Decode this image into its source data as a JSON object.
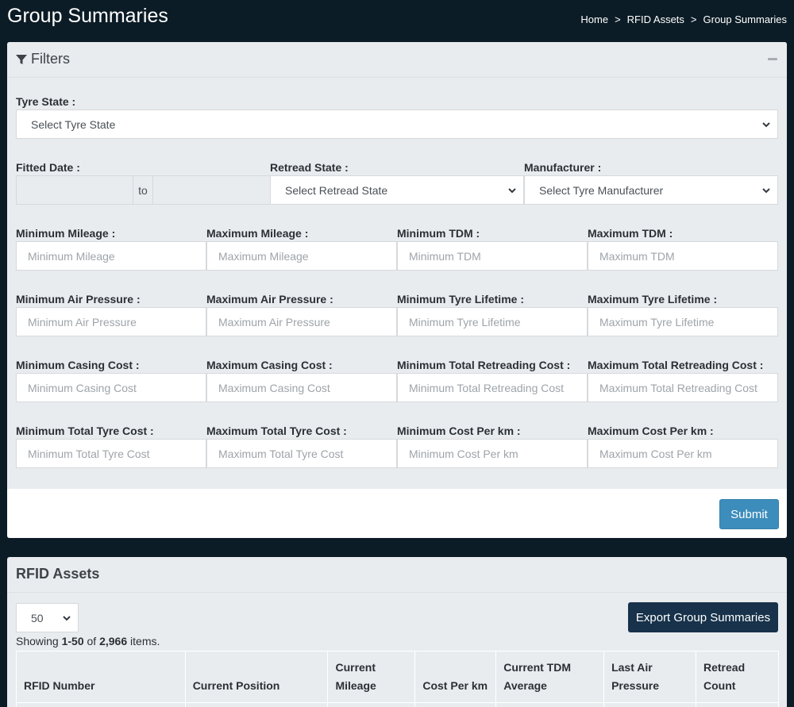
{
  "header": {
    "title": "Group Summaries",
    "breadcrumb": [
      "Home",
      "RFID Assets",
      "Group Summaries"
    ],
    "separator": ">"
  },
  "filters": {
    "title": "Filters",
    "tyre_state": {
      "label": "Tyre State :",
      "value": "Select Tyre State"
    },
    "fitted_date": {
      "label": "Fitted Date :",
      "to": "to"
    },
    "retread_state": {
      "label": "Retread State :",
      "value": "Select Retread State"
    },
    "manufacturer": {
      "label": "Manufacturer :",
      "value": "Select Tyre Manufacturer"
    },
    "min_mileage": {
      "label": "Minimum Mileage :",
      "placeholder": "Minimum Mileage"
    },
    "max_mileage": {
      "label": "Maximum Mileage :",
      "placeholder": "Maximum Mileage"
    },
    "min_tdm": {
      "label": "Minimum TDM :",
      "placeholder": "Minimum TDM"
    },
    "max_tdm": {
      "label": "Maximum TDM :",
      "placeholder": "Maximum TDM"
    },
    "min_air": {
      "label": "Minimum Air Pressure :",
      "placeholder": "Minimum Air Pressure"
    },
    "max_air": {
      "label": "Maximum Air Pressure :",
      "placeholder": "Maximum Air Pressure"
    },
    "min_life": {
      "label": "Minimum Tyre Lifetime :",
      "placeholder": "Minimum Tyre Lifetime"
    },
    "max_life": {
      "label": "Maximum Tyre Lifetime :",
      "placeholder": "Maximum Tyre Lifetime"
    },
    "min_casing": {
      "label": "Minimum Casing Cost :",
      "placeholder": "Minimum Casing Cost"
    },
    "max_casing": {
      "label": "Maximum Casing Cost :",
      "placeholder": "Maximum Casing Cost"
    },
    "min_retread": {
      "label": "Minimum Total Retreading Cost :",
      "placeholder": "Minimum Total Retreading Cost"
    },
    "max_retread": {
      "label": "Maximum Total Retreading Cost :",
      "placeholder": "Maximum Total Retreading Cost"
    },
    "min_tyrecost": {
      "label": "Minimum Total Tyre Cost :",
      "placeholder": "Minimum Total Tyre Cost"
    },
    "max_tyrecost": {
      "label": "Maximum Total Tyre Cost :",
      "placeholder": "Maximum Total Tyre Cost"
    },
    "min_cpk": {
      "label": "Minimum Cost Per km :",
      "placeholder": "Minimum Cost Per km"
    },
    "max_cpk": {
      "label": "Maximum Cost Per km :",
      "placeholder": "Maximum Cost Per km"
    },
    "submit_label": "Submit"
  },
  "assets": {
    "title": "RFID Assets",
    "page_size": "50",
    "export_label": "Export Group Summaries",
    "summary": {
      "prefix": "Showing ",
      "range": "1-50",
      "of": " of ",
      "total": "2,966",
      "suffix": " items."
    },
    "columns": [
      {
        "line1": "",
        "line2": "RFID Number"
      },
      {
        "line1": "",
        "line2": "Current Position"
      },
      {
        "line1": "Current",
        "line2": "Mileage"
      },
      {
        "line1": "",
        "line2": "Cost Per km"
      },
      {
        "line1": "Current TDM",
        "line2": "Average"
      },
      {
        "line1": "Last Air",
        "line2": "Pressure"
      },
      {
        "line1": "Retread",
        "line2": "Count"
      }
    ]
  },
  "colors": {
    "background": "#0c1c26",
    "primary_button": "#3c8dbc",
    "export_button": "#17324a"
  }
}
